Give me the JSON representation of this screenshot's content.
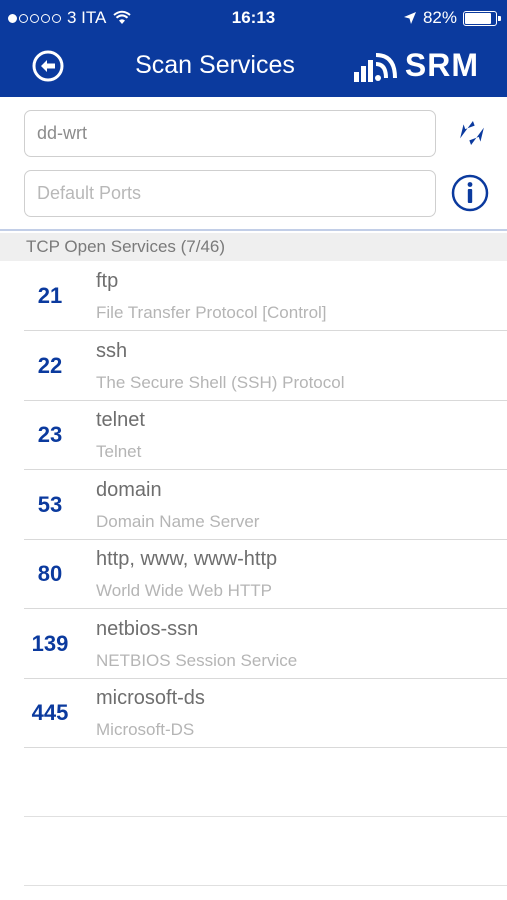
{
  "status_bar": {
    "carrier": "3 ITA",
    "time": "16:13",
    "battery": "82%"
  },
  "navbar": {
    "title": "Scan Services",
    "logo": "SRM",
    "back_icon": "back-arrow-circle-icon"
  },
  "form": {
    "host_value": "dd-wrt",
    "ports_placeholder": "Default Ports",
    "refresh_icon": "refresh-arrows-icon",
    "info_icon": "info-circle-icon"
  },
  "section": {
    "title": "TCP Open Services (7/46)"
  },
  "services": [
    {
      "port": "21",
      "name": "ftp",
      "description": "File Transfer Protocol [Control]"
    },
    {
      "port": "22",
      "name": "ssh",
      "description": "The Secure Shell (SSH) Protocol"
    },
    {
      "port": "23",
      "name": "telnet",
      "description": "Telnet"
    },
    {
      "port": "53",
      "name": "domain",
      "description": "Domain Name Server"
    },
    {
      "port": "80",
      "name": "http, www, www-http",
      "description": "World Wide Web HTTP"
    },
    {
      "port": "139",
      "name": "netbios-ssn",
      "description": "NETBIOS Session Service"
    },
    {
      "port": "445",
      "name": "microsoft-ds",
      "description": "Microsoft-DS"
    }
  ],
  "colors": {
    "brand": "#0b3a9e",
    "section_bg": "#efefef"
  }
}
